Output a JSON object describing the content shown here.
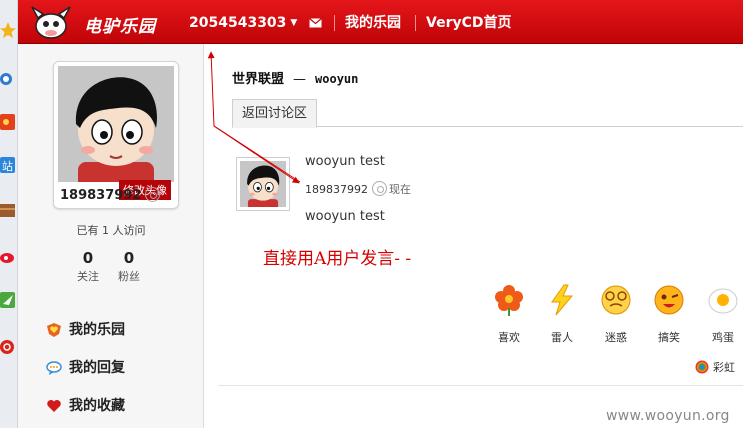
{
  "header": {
    "logo_text": "电驴乐园",
    "user_id": "2054543303",
    "nav": {
      "my_park": "我的乐园",
      "verycd_home": "VeryCD首页"
    }
  },
  "sidebar": {
    "edit_avatar": "修改头像",
    "uid": "189837992",
    "visits": "已有 1 人访问",
    "stats": [
      {
        "num": "0",
        "label": "关注"
      },
      {
        "num": "0",
        "label": "粉丝"
      }
    ],
    "links": [
      "我的乐园",
      "我的回复",
      "我的收藏"
    ]
  },
  "main": {
    "breadcrumb": {
      "group": "世界联盟",
      "user": "wooyun"
    },
    "back_tab": "返回讨论区",
    "post": {
      "title": "wooyun test",
      "author_id": "189837992",
      "time": "现在",
      "body": "wooyun test"
    },
    "annotation": "直接用A用户发言- -",
    "reactions": [
      "喜欢",
      "雷人",
      "迷惑",
      "搞笑",
      "鸡蛋"
    ],
    "rainbow_label": "彩虹"
  },
  "watermark": "www.wooyun.org",
  "colors": {
    "header_red": "#d40b10",
    "annotation_red": "#d60000"
  }
}
